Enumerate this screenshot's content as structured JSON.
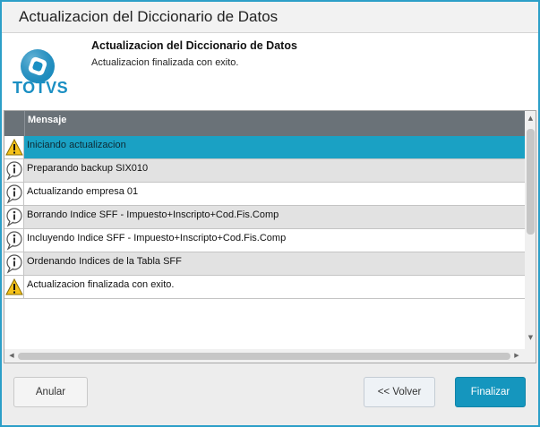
{
  "window": {
    "title": "Actualizacion del Diccionario de Datos"
  },
  "header": {
    "logo_text": "TOTVS",
    "title": "Actualizacion del Diccionario de Datos",
    "subtitle": "Actualizacion finalizada con exito."
  },
  "grid": {
    "column_header": "Mensaje",
    "rows": [
      {
        "icon": "warning-icon",
        "text": "Iniciando actualizacion",
        "selected": true
      },
      {
        "icon": "info-icon",
        "text": "Preparando backup SIX010",
        "selected": false
      },
      {
        "icon": "info-icon",
        "text": "Actualizando empresa 01",
        "selected": false
      },
      {
        "icon": "info-icon",
        "text": "Borrando Indice SFF - Impuesto+Inscripto+Cod.Fis.Comp",
        "selected": false
      },
      {
        "icon": "info-icon",
        "text": "Incluyendo Indice SFF - Impuesto+Inscripto+Cod.Fis.Comp",
        "selected": false
      },
      {
        "icon": "info-icon",
        "text": "Ordenando Indices de la Tabla SFF",
        "selected": false
      },
      {
        "icon": "warning-icon",
        "text": "Actualizacion finalizada con exito.",
        "selected": false
      }
    ]
  },
  "buttons": {
    "anular": "Anular",
    "volver": "<< Volver",
    "finalizar": "Finalizar"
  },
  "colors": {
    "accent": "#1596be",
    "selected_row": "#1aa1c4",
    "header_bg": "#6a7278",
    "border": "#2c9fc8"
  }
}
